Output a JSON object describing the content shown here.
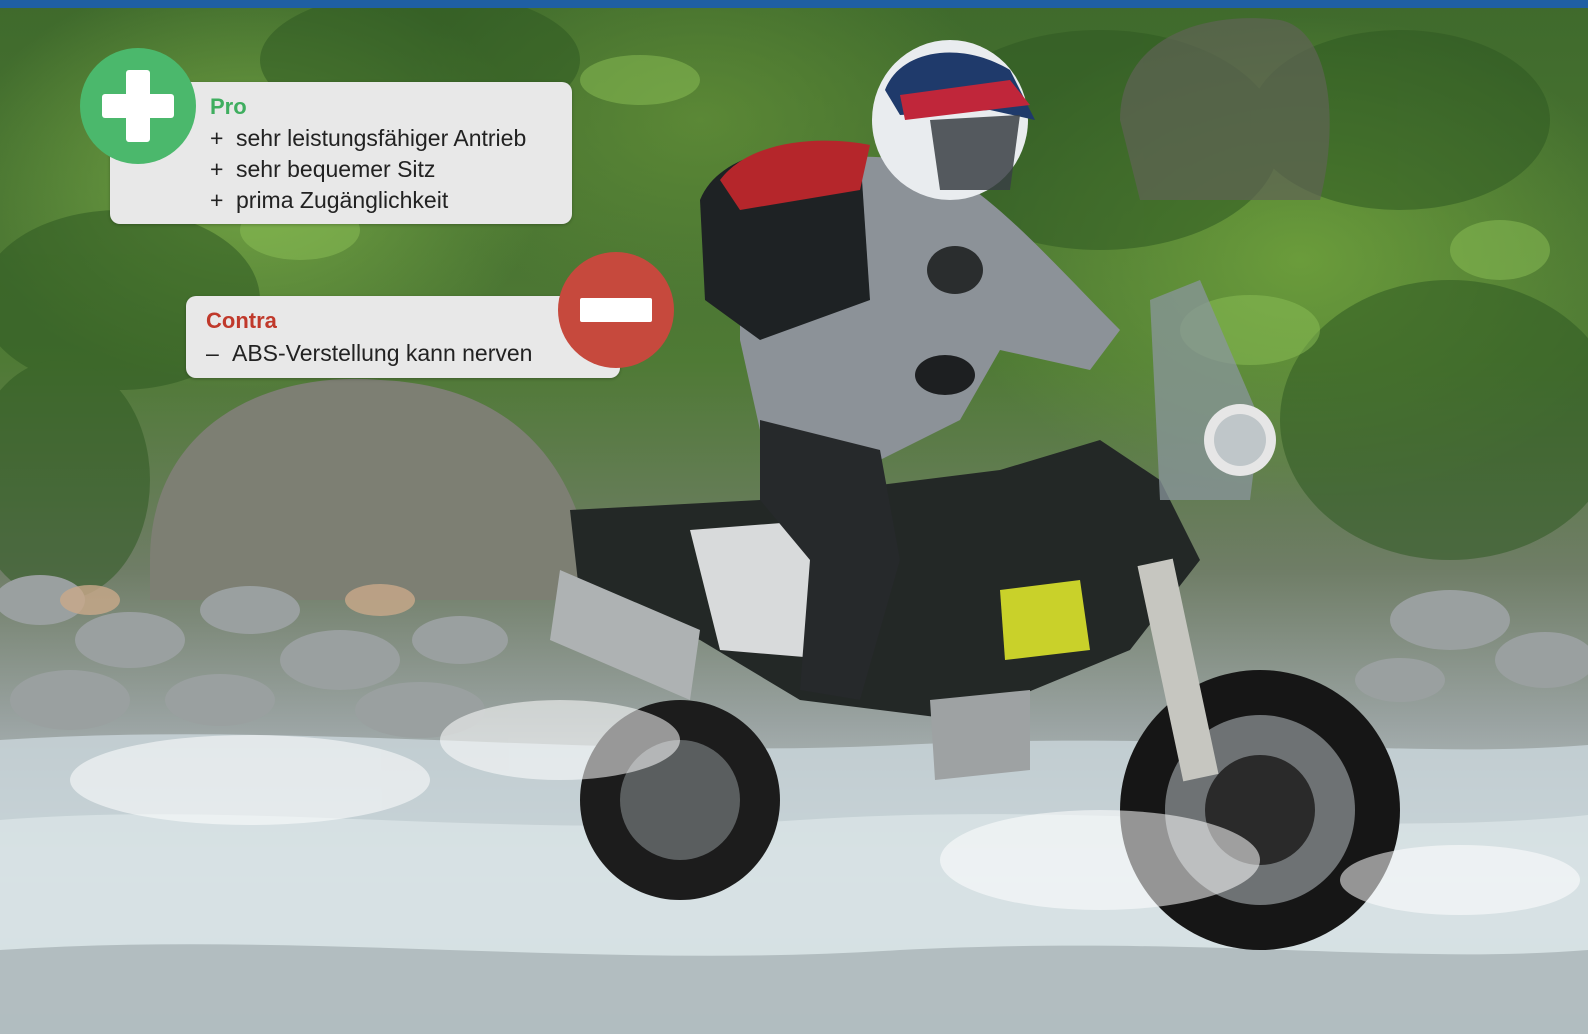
{
  "pro": {
    "heading": "Pro",
    "items": [
      {
        "symbol": "+",
        "text": "sehr leistungsfähiger Antrieb"
      },
      {
        "symbol": "+",
        "text": "sehr bequemer Sitz"
      },
      {
        "symbol": "+",
        "text": "prima Zugänglichkeit"
      }
    ],
    "icon": "plus-icon",
    "color": "#4bb86c",
    "heading_color": "#3fae5f"
  },
  "contra": {
    "heading": "Contra",
    "items": [
      {
        "symbol": "–",
        "text": "ABS-Verstellung kann nerven"
      }
    ],
    "icon": "minus-icon",
    "color": "#c6493d",
    "heading_color": "#c0392b"
  },
  "accent_bar_color": "#1f5fa3"
}
